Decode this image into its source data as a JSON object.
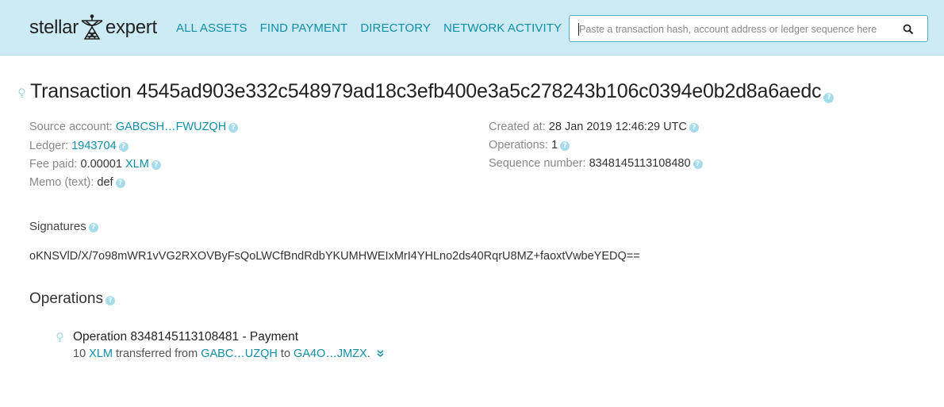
{
  "header": {
    "logo_left": "stellar",
    "logo_right": "expert",
    "nav": [
      "ALL ASSETS",
      "FIND PAYMENT",
      "DIRECTORY",
      "NETWORK ACTIVITY"
    ],
    "search_placeholder": "Paste a transaction hash, account address or ledger sequence here"
  },
  "transaction": {
    "title_prefix": "Transaction",
    "hash": "4545ad903e332c548979ad18c3efb400e3a5c278243b106c0394e0b2d8a6aedc",
    "source_label": "Source account:",
    "source_value": "GABCSH…FWUZQH",
    "ledger_label": "Ledger:",
    "ledger_value": "1943704",
    "fee_label": "Fee paid:",
    "fee_amount": "0.00001",
    "fee_asset": "XLM",
    "memo_label": "Memo (text):",
    "memo_value": "def",
    "created_label": "Created at:",
    "created_value": "28 Jan 2019 12:46:29 UTC",
    "operations_label": "Operations:",
    "operations_value": "1",
    "sequence_label": "Sequence number:",
    "sequence_value": "8348145113108480"
  },
  "signatures": {
    "heading": "Signatures",
    "value": "oKNSVlD/X/7o98mWR1vVG2RXOVByFsQoLWCfBndRdbYKUMHWEIxMrI4YHLno2ds40RqrU8MZ+faoxtVwbeYEDQ=="
  },
  "operations": {
    "heading": "Operations",
    "items": [
      {
        "title": "Operation 8348145113108481 - Payment",
        "amount": "10",
        "asset": "XLM",
        "text_transferred": "transferred from",
        "from": "GABC…UZQH",
        "text_to": "to",
        "to": "GA4O…JMZX",
        "period": "."
      }
    ]
  },
  "colors": {
    "header_bg": "#cdebf4",
    "link": "#0e8fa8",
    "help_icon": "#a6dcea"
  }
}
